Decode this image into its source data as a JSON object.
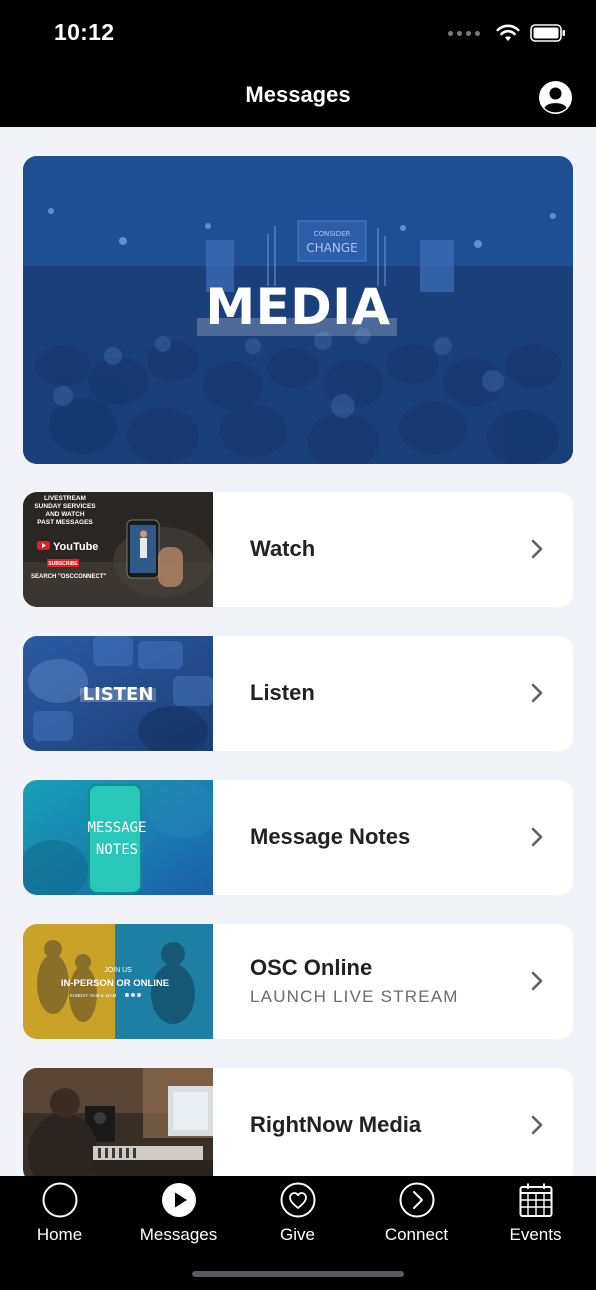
{
  "status_bar": {
    "time": "10:12"
  },
  "header": {
    "title": "Messages"
  },
  "hero": {
    "title": "MEDIA",
    "stage_screen_text": [
      "CONSIDER",
      "CHANGE"
    ]
  },
  "cards": [
    {
      "title": "Watch",
      "thumb_text": [
        "LIVESTREAM",
        "SUNDAY SERVICES",
        "AND WATCH",
        "PAST MESSAGES",
        "YouTube",
        "SUBSCRIBE",
        "SEARCH \"OSCCONNECT\""
      ]
    },
    {
      "title": "Listen",
      "thumb_text": [
        "LISTEN"
      ]
    },
    {
      "title": "Message Notes",
      "thumb_text": [
        "MESSAGE",
        "NOTES"
      ]
    },
    {
      "title": "OSC Online",
      "subtitle": "LAUNCH LIVE STREAM",
      "thumb_text": [
        "JOIN US",
        "IN-PERSON OR ONLINE",
        "SUNDAY: 9AM & 11AM"
      ]
    },
    {
      "title": "RightNow Media"
    }
  ],
  "tabs": [
    {
      "label": "Home",
      "icon": "home-circle-icon"
    },
    {
      "label": "Messages",
      "icon": "play-circle-icon"
    },
    {
      "label": "Give",
      "icon": "heart-circle-icon"
    },
    {
      "label": "Connect",
      "icon": "chevron-circle-icon"
    },
    {
      "label": "Events",
      "icon": "calendar-icon"
    }
  ],
  "colors": {
    "header_bg": "#000000",
    "page_bg": "#f2f3f8",
    "hero_blue": "#1a4480",
    "text_primary": "#222222",
    "text_secondary": "#6b6b70"
  }
}
